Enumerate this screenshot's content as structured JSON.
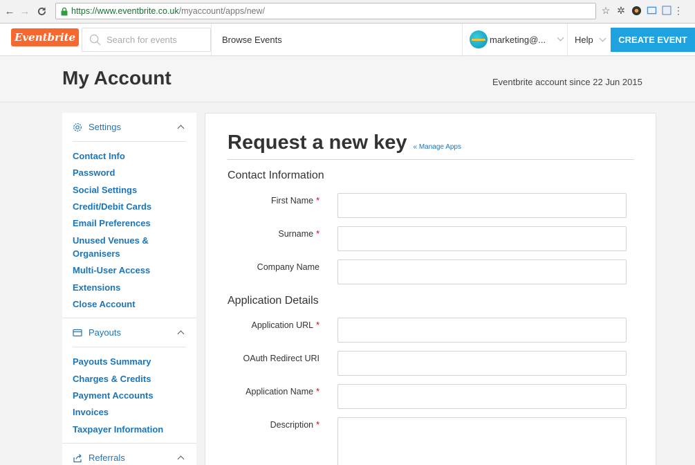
{
  "browser": {
    "url_host": "https://www.eventbrite.co.uk",
    "url_path": "/myaccount/apps/new/",
    "icons": [
      "back-icon",
      "forward-icon",
      "reload-icon",
      "lock-icon",
      "star-icon",
      "extension-icon",
      "chrome-extension-icon",
      "cast-icon",
      "pdf-icon",
      "menu-icon"
    ]
  },
  "header": {
    "logo": "Eventbrite",
    "search_placeholder": "Search for events",
    "browse": "Browse Events",
    "account_email": "marketing@...",
    "help": "Help",
    "create_event": "CREATE EVENT"
  },
  "banner": {
    "title": "My Account",
    "since": "Eventbrite account since 22 Jun 2015"
  },
  "sidebar": {
    "settings": {
      "title": "Settings",
      "items": [
        "Contact Info",
        "Password",
        "Social Settings",
        "Credit/Debit Cards",
        "Email Preferences",
        "Unused Venues & Organisers",
        "Multi-User Access",
        "Extensions",
        "Close Account"
      ]
    },
    "payouts": {
      "title": "Payouts",
      "items": [
        "Payouts Summary",
        "Charges & Credits",
        "Payment Accounts",
        "Invoices",
        "Taxpayer Information"
      ]
    },
    "referrals": {
      "title": "Referrals"
    }
  },
  "main": {
    "title": "Request a new key",
    "manage_link": "« Manage Apps",
    "contact_heading": "Contact Information",
    "app_heading": "Application Details",
    "fields": {
      "first_name": {
        "label": "First Name",
        "required": "*",
        "value": ""
      },
      "surname": {
        "label": "Surname",
        "required": "*",
        "value": ""
      },
      "company": {
        "label": "Company Name",
        "value": ""
      },
      "app_url": {
        "label": "Application URL",
        "required": "*",
        "value": ""
      },
      "oauth": {
        "label": "OAuth Redirect URI",
        "value": ""
      },
      "app_name": {
        "label": "Application Name",
        "required": "*",
        "value": ""
      },
      "description": {
        "label": "Description",
        "required": "*",
        "value": ""
      }
    }
  },
  "colors": {
    "brand_orange": "#f6682f",
    "link_blue": "#1b75bb",
    "button_blue": "#1ea2e0",
    "required_red": "#d0021b"
  }
}
